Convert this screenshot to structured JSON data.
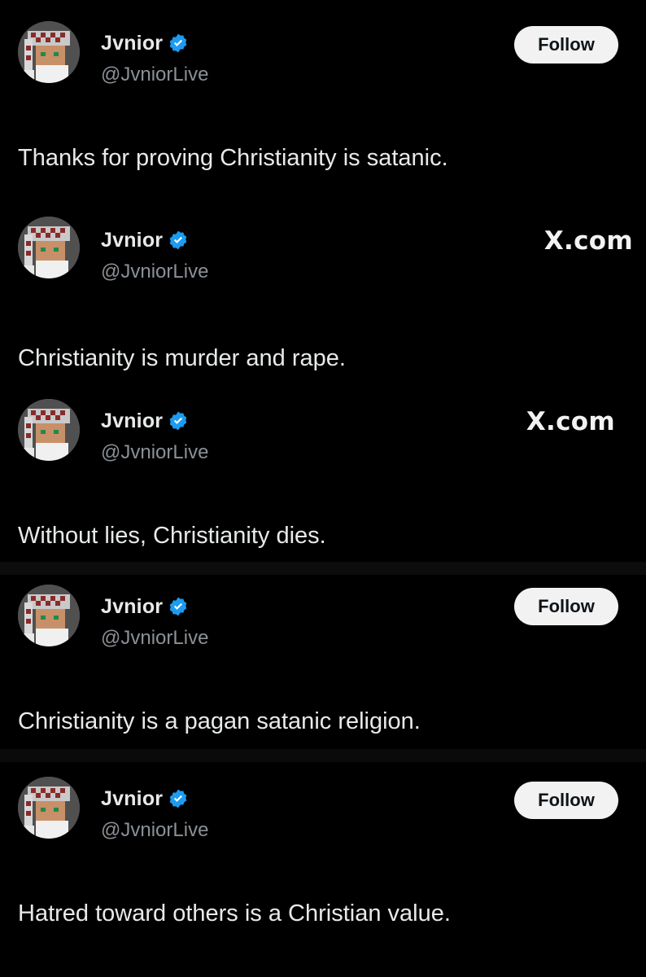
{
  "posts": [
    {
      "display_name": "Jvnior",
      "handle": "@JvniorLive",
      "verified": true,
      "action": "Follow",
      "text": "Thanks for proving Christianity is satanic."
    },
    {
      "display_name": "Jvnior",
      "handle": "@JvniorLive",
      "verified": true,
      "action": "X.com",
      "text": "Christianity is murder and rape."
    },
    {
      "display_name": "Jvnior",
      "handle": "@JvniorLive",
      "verified": true,
      "action": "X.com",
      "text": "Without lies, Christianity dies."
    },
    {
      "display_name": "Jvnior",
      "handle": "@JvniorLive",
      "verified": true,
      "action": "Follow",
      "text": "Christianity is a pagan satanic religion."
    },
    {
      "display_name": "Jvnior",
      "handle": "@JvniorLive",
      "verified": true,
      "action": "Follow",
      "text": "Hatred toward others is a Christian value."
    }
  ],
  "colors": {
    "background": "#000000",
    "text": "#e7e9ea",
    "handle": "#8b9096",
    "verified_badge": "#1d9bf0",
    "follow_button_bg": "#f2f2f2",
    "follow_button_text": "#0f1419"
  },
  "icons": {
    "verified": "verified-badge-icon",
    "avatar": "pixel-art-avatar"
  }
}
